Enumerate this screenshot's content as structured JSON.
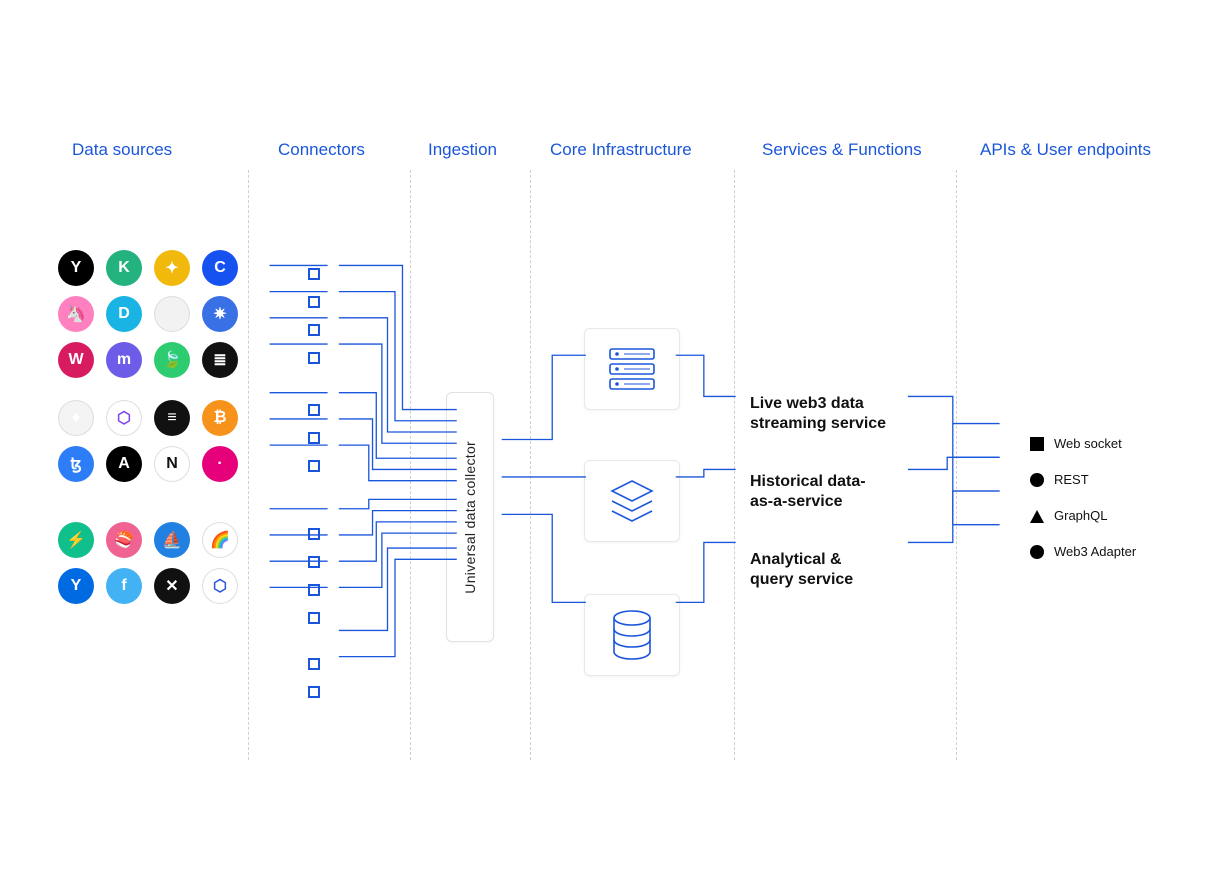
{
  "columns": {
    "data_sources": "Data sources",
    "connectors": "Connectors",
    "ingestion": "Ingestion",
    "core_infra": "Core Infrastructure",
    "services": "Services & Functions",
    "apis": "APIs & User endpoints"
  },
  "ingestion": {
    "label": "Universal data collector"
  },
  "services_list": {
    "s1": "Live web3 data\nstreaming service",
    "s2": "Historical data-\nas-a-service",
    "s3": "Analytical &\nquery service"
  },
  "apis_list": {
    "a1": "Web socket",
    "a2": "REST",
    "a3": "GraphQL",
    "a4": "Web3 Adapter"
  },
  "core_icons": {
    "c1": "servers-icon",
    "c2": "layers-icon",
    "c3": "database-icon"
  },
  "source_groups": [
    {
      "rows": 3,
      "icons": [
        {
          "name": "xyo",
          "bg": "#000",
          "txt": "Y"
        },
        {
          "name": "kucoin",
          "bg": "#24b37e",
          "txt": "K"
        },
        {
          "name": "binance",
          "bg": "#f0b90b",
          "txt": "✦"
        },
        {
          "name": "coinbase",
          "bg": "#1652f0",
          "txt": "C"
        },
        {
          "name": "uniswap",
          "bg": "#ff80bf",
          "txt": "🦄"
        },
        {
          "name": "dash",
          "bg": "#19b4e3",
          "txt": "D"
        },
        {
          "name": "huobi",
          "bg": "#f2f2f2",
          "txt": ""
        },
        {
          "name": "cosmos",
          "bg": "#3970e6",
          "txt": "✷"
        },
        {
          "name": "westpac",
          "bg": "#d81b60",
          "txt": "W"
        },
        {
          "name": "kraken",
          "bg": "#6c5ce7",
          "txt": "m"
        },
        {
          "name": "leaf",
          "bg": "#2ecc71",
          "txt": "🍃"
        },
        {
          "name": "stacks",
          "bg": "#111",
          "txt": "≣"
        }
      ]
    },
    {
      "rows": 2,
      "icons": [
        {
          "name": "ethereum",
          "bg": "#f4f4f4",
          "txt": "♦"
        },
        {
          "name": "polygon",
          "bg": "#ffffff",
          "txt": "⬡",
          "fg": "#8247e5"
        },
        {
          "name": "solana",
          "bg": "#111",
          "txt": "≡",
          "grad": true
        },
        {
          "name": "bitcoin",
          "bg": "#f7931a",
          "txt": "₿"
        },
        {
          "name": "tezos",
          "bg": "#2c7df7",
          "txt": "ꜩ"
        },
        {
          "name": "algorand",
          "bg": "#000",
          "txt": "A"
        },
        {
          "name": "near",
          "bg": "#fff",
          "txt": "N",
          "fg": "#111"
        },
        {
          "name": "polkadot",
          "bg": "#e6007a",
          "txt": "·"
        }
      ]
    },
    {
      "rows": 2,
      "icons": [
        {
          "name": "thorchain",
          "bg": "#0fbf8c",
          "txt": "⚡"
        },
        {
          "name": "sushiswap",
          "bg": "#f06292",
          "txt": "🍣"
        },
        {
          "name": "opensea",
          "bg": "#2081e2",
          "txt": "⛵"
        },
        {
          "name": "rainbow",
          "bg": "#fff",
          "txt": "🌈"
        },
        {
          "name": "yearn",
          "bg": "#006ae3",
          "txt": "Y"
        },
        {
          "name": "filecoin",
          "bg": "#42b2f4",
          "txt": "f"
        },
        {
          "name": "ripple",
          "bg": "#111",
          "txt": "✕"
        },
        {
          "name": "chainlink",
          "bg": "#fff",
          "txt": "⬡",
          "fg": "#2a5ada"
        }
      ]
    }
  ]
}
